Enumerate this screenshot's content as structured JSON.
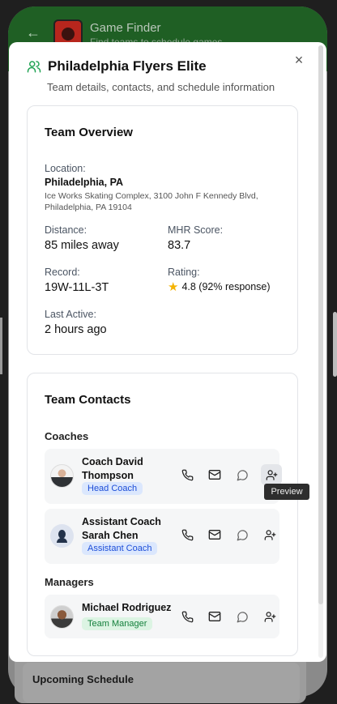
{
  "app": {
    "title": "Game Finder",
    "subtitle": "Find teams to schedule games",
    "background_card_title": "Upcoming Schedule"
  },
  "modal": {
    "title": "Philadelphia Flyers Elite",
    "description": "Team details, contacts, and schedule information",
    "close_label": "×"
  },
  "overview": {
    "title": "Team Overview",
    "location_label": "Location:",
    "location_value": "Philadelphia, PA",
    "address_line1": "Ice Works Skating Complex, 3100 John F Kennedy Blvd,",
    "address_line2": "Philadelphia, PA 19104",
    "distance_label": "Distance:",
    "distance_value": "85 miles away",
    "mhr_label": "MHR Score:",
    "mhr_value": "83.7",
    "record_label": "Record:",
    "record_value": "19W-11L-3T",
    "rating_label": "Rating:",
    "rating_value": "4.8 (92% response)",
    "last_active_label": "Last Active:",
    "last_active_value": "2 hours ago"
  },
  "contacts": {
    "title": "Team Contacts",
    "coaches_label": "Coaches",
    "managers_label": "Managers",
    "coaches": [
      {
        "name": "Coach David Thompson",
        "role": "Head Coach"
      },
      {
        "name": "Assistant Coach Sarah Chen",
        "role": "Assistant Coach"
      }
    ],
    "managers": [
      {
        "name": "Michael Rodriguez",
        "role": "Team Manager"
      }
    ]
  },
  "tooltip": {
    "text": "Preview"
  },
  "icons": [
    "arrow-left-icon",
    "users-icon",
    "close-icon",
    "phone-icon",
    "mail-icon",
    "message-icon",
    "user-plus-icon",
    "star-icon"
  ],
  "colors": {
    "header_green": "#1f5f24",
    "badge_blue_bg": "#dbe7fd",
    "badge_blue_text": "#1d4ed8",
    "badge_green_bg": "#dcf4e3",
    "badge_green_text": "#15803d",
    "star": "#f5b300"
  }
}
